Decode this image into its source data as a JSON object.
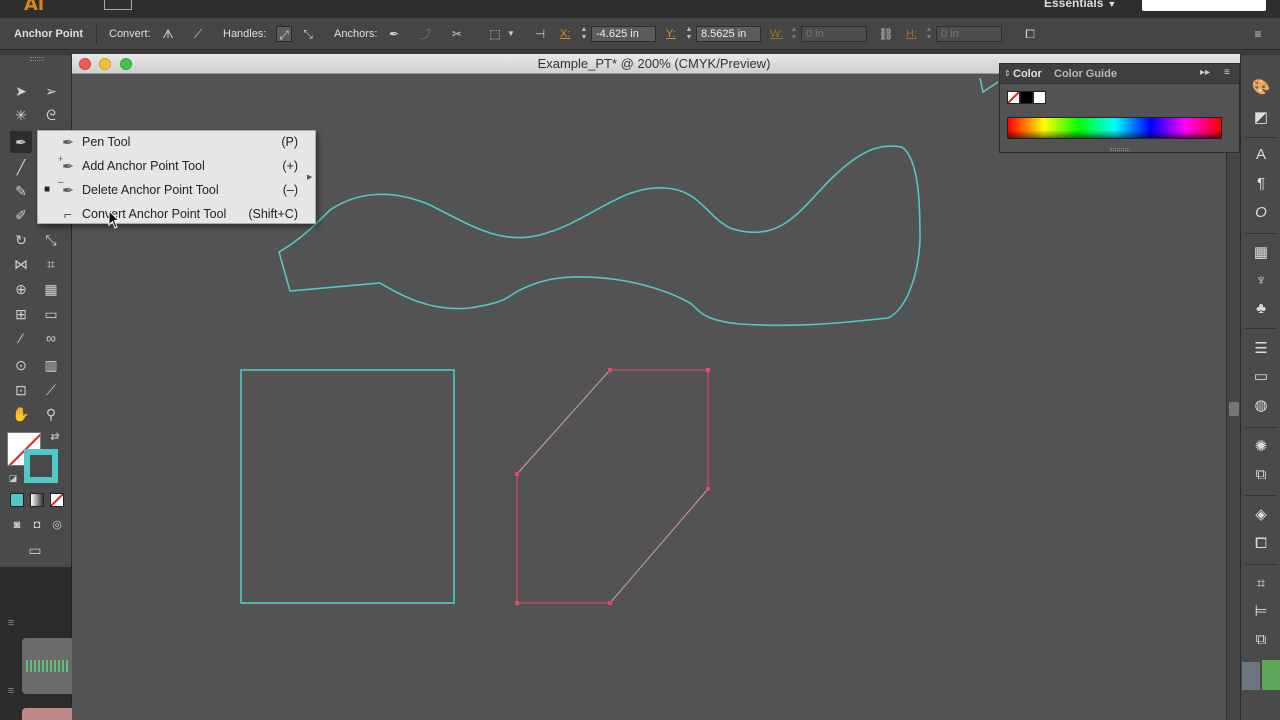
{
  "app": {
    "logo": "Ai",
    "workspace": "Essentials"
  },
  "controlbar": {
    "tool_name": "Anchor Point",
    "convert_label": "Convert:",
    "handles_label": "Handles:",
    "anchors_label": "Anchors:",
    "x_label": "X:",
    "x_value": "-4.625 in",
    "y_label": "Y:",
    "y_value": "8.5625 in",
    "w_label": "W:",
    "w_value": "0 in",
    "h_label": "H:",
    "h_value": "0 in"
  },
  "document": {
    "title": "Example_PT* @ 200% (CMYK/Preview)"
  },
  "flyout": {
    "items": [
      {
        "label": "Pen Tool",
        "shortcut": "(P)",
        "selected": false,
        "icon": "pen-icon"
      },
      {
        "label": "Add Anchor Point Tool",
        "shortcut": "(+)",
        "selected": false,
        "icon": "add-anchor-icon"
      },
      {
        "label": "Delete Anchor Point Tool",
        "shortcut": "(–)",
        "selected": true,
        "icon": "delete-anchor-icon"
      },
      {
        "label": "Convert Anchor Point Tool",
        "shortcut": "(Shift+C)",
        "selected": false,
        "icon": "convert-anchor-icon"
      }
    ]
  },
  "color_panel": {
    "tabs": [
      "Color",
      "Color Guide"
    ]
  },
  "colors": {
    "stroke": "#51c7c7",
    "selection": "#e8466a",
    "canvas": "#535353",
    "accent": "#d9902a"
  }
}
